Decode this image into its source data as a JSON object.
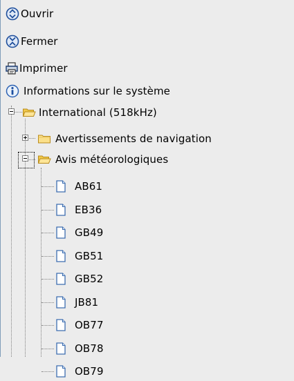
{
  "menu": {
    "open_label": "Ouvrir",
    "close_label": "Fermer",
    "print_label": "Imprimer",
    "info_label": "Informations sur le système"
  },
  "tree": {
    "root_label": "International (518kHz)",
    "nav_warnings_label": "Avertissements de navigation",
    "weather_label": "Avis météorologiques",
    "items": [
      "AB61",
      "EB36",
      "GB49",
      "GB51",
      "GB52",
      "JB81",
      "OB77",
      "OB78",
      "OB79"
    ]
  },
  "colors": {
    "background": "#ececec",
    "tree_line": "#808080",
    "folder": "#f4d86c",
    "document": "#4a7ebb"
  }
}
